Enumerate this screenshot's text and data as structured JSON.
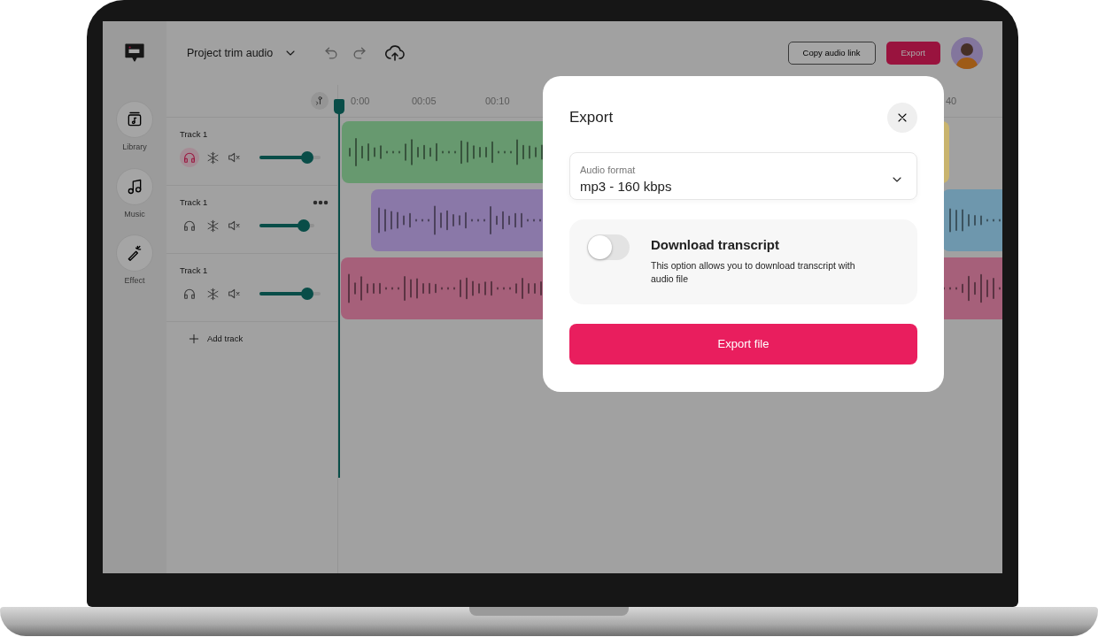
{
  "app": {
    "project_title": "Project trim audio",
    "copy_link_button": "Copy audio link",
    "export_button": "Export"
  },
  "rail": [
    {
      "label": "Library",
      "kind": "library"
    },
    {
      "label": "Music",
      "kind": "music"
    },
    {
      "label": "Effect",
      "kind": "effect"
    }
  ],
  "ruler": {
    "ticks": [
      "0:00",
      "00:05",
      "00:10",
      "40"
    ]
  },
  "tracks": [
    {
      "name": "Track 1",
      "listen": true,
      "more_menu": false,
      "level": 0.78,
      "clips": [
        {
          "color": "#67996f"
        },
        {
          "color": "#c9b46e"
        }
      ]
    },
    {
      "name": "Track 1",
      "listen": false,
      "more_menu": true,
      "level": 0.8,
      "clips": [
        {
          "color": "#8a78a8"
        },
        {
          "color": "#6e97ad"
        }
      ]
    },
    {
      "name": "Track 1",
      "listen": false,
      "more_menu": false,
      "level": 0.78,
      "clips": [
        {
          "color": "#a6607a"
        }
      ]
    }
  ],
  "add_track": "Add track",
  "modal": {
    "title": "Export",
    "format_field": {
      "label": "Audio format",
      "value": "mp3 - 160 kbps"
    },
    "transcript": {
      "on": false,
      "title": "Download transcript",
      "description": "This option allows you to download transcript with audio file"
    },
    "submit": "Export file"
  }
}
